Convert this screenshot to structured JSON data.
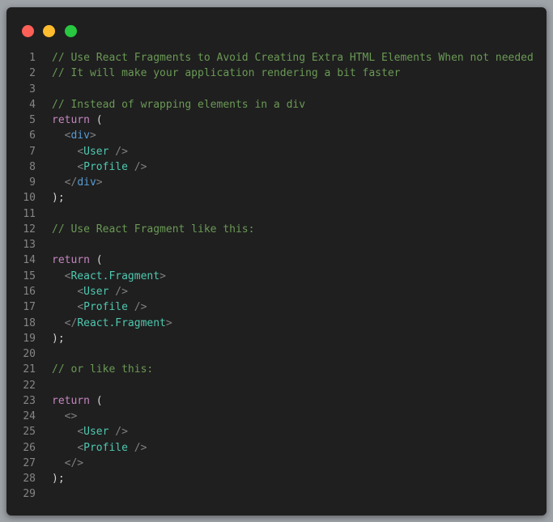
{
  "editor": {
    "lines": [
      {
        "n": "1",
        "tokens": [
          {
            "t": "// Use React Fragments to Avoid Creating Extra HTML Elements When not needed",
            "c": "comment"
          }
        ]
      },
      {
        "n": "2",
        "tokens": [
          {
            "t": "// It will make your application rendering a bit faster",
            "c": "comment"
          }
        ]
      },
      {
        "n": "3",
        "tokens": []
      },
      {
        "n": "4",
        "tokens": [
          {
            "t": "// Instead of wrapping elements in a div",
            "c": "comment"
          }
        ]
      },
      {
        "n": "5",
        "tokens": [
          {
            "t": "return",
            "c": "keyword"
          },
          {
            "t": " (",
            "c": "punct"
          }
        ]
      },
      {
        "n": "6",
        "tokens": [
          {
            "t": "  ",
            "c": "punct"
          },
          {
            "t": "<",
            "c": "tagbr"
          },
          {
            "t": "div",
            "c": "html"
          },
          {
            "t": ">",
            "c": "tagbr"
          }
        ]
      },
      {
        "n": "7",
        "tokens": [
          {
            "t": "    ",
            "c": "punct"
          },
          {
            "t": "<",
            "c": "tagbr"
          },
          {
            "t": "User",
            "c": "comp"
          },
          {
            "t": " />",
            "c": "tagbr"
          }
        ]
      },
      {
        "n": "8",
        "tokens": [
          {
            "t": "    ",
            "c": "punct"
          },
          {
            "t": "<",
            "c": "tagbr"
          },
          {
            "t": "Profile",
            "c": "comp"
          },
          {
            "t": " />",
            "c": "tagbr"
          }
        ]
      },
      {
        "n": "9",
        "tokens": [
          {
            "t": "  ",
            "c": "punct"
          },
          {
            "t": "</",
            "c": "tagbr"
          },
          {
            "t": "div",
            "c": "html"
          },
          {
            "t": ">",
            "c": "tagbr"
          }
        ]
      },
      {
        "n": "10",
        "tokens": [
          {
            "t": ");",
            "c": "punct"
          }
        ]
      },
      {
        "n": "11",
        "tokens": []
      },
      {
        "n": "12",
        "tokens": [
          {
            "t": "// Use React Fragment like this:",
            "c": "comment"
          }
        ]
      },
      {
        "n": "13",
        "tokens": []
      },
      {
        "n": "14",
        "tokens": [
          {
            "t": "return",
            "c": "keyword"
          },
          {
            "t": " (",
            "c": "punct"
          }
        ]
      },
      {
        "n": "15",
        "tokens": [
          {
            "t": "  ",
            "c": "punct"
          },
          {
            "t": "<",
            "c": "tagbr"
          },
          {
            "t": "React.Fragment",
            "c": "comp"
          },
          {
            "t": ">",
            "c": "tagbr"
          }
        ]
      },
      {
        "n": "16",
        "tokens": [
          {
            "t": "    ",
            "c": "punct"
          },
          {
            "t": "<",
            "c": "tagbr"
          },
          {
            "t": "User",
            "c": "comp"
          },
          {
            "t": " />",
            "c": "tagbr"
          }
        ]
      },
      {
        "n": "17",
        "tokens": [
          {
            "t": "    ",
            "c": "punct"
          },
          {
            "t": "<",
            "c": "tagbr"
          },
          {
            "t": "Profile",
            "c": "comp"
          },
          {
            "t": " />",
            "c": "tagbr"
          }
        ]
      },
      {
        "n": "18",
        "tokens": [
          {
            "t": "  ",
            "c": "punct"
          },
          {
            "t": "</",
            "c": "tagbr"
          },
          {
            "t": "React.Fragment",
            "c": "comp"
          },
          {
            "t": ">",
            "c": "tagbr"
          }
        ]
      },
      {
        "n": "19",
        "tokens": [
          {
            "t": ");",
            "c": "punct"
          }
        ]
      },
      {
        "n": "20",
        "tokens": []
      },
      {
        "n": "21",
        "tokens": [
          {
            "t": "// or like this:",
            "c": "comment"
          }
        ]
      },
      {
        "n": "22",
        "tokens": []
      },
      {
        "n": "23",
        "tokens": [
          {
            "t": "return",
            "c": "keyword"
          },
          {
            "t": " (",
            "c": "punct"
          }
        ]
      },
      {
        "n": "24",
        "tokens": [
          {
            "t": "  ",
            "c": "punct"
          },
          {
            "t": "<>",
            "c": "tagbr"
          }
        ]
      },
      {
        "n": "25",
        "tokens": [
          {
            "t": "    ",
            "c": "punct"
          },
          {
            "t": "<",
            "c": "tagbr"
          },
          {
            "t": "User",
            "c": "comp"
          },
          {
            "t": " />",
            "c": "tagbr"
          }
        ]
      },
      {
        "n": "26",
        "tokens": [
          {
            "t": "    ",
            "c": "punct"
          },
          {
            "t": "<",
            "c": "tagbr"
          },
          {
            "t": "Profile",
            "c": "comp"
          },
          {
            "t": " />",
            "c": "tagbr"
          }
        ]
      },
      {
        "n": "27",
        "tokens": [
          {
            "t": "  ",
            "c": "punct"
          },
          {
            "t": "</>",
            "c": "tagbr"
          }
        ]
      },
      {
        "n": "28",
        "tokens": [
          {
            "t": ");",
            "c": "punct"
          }
        ]
      },
      {
        "n": "29",
        "tokens": []
      }
    ]
  },
  "colors": {
    "window_bg": "#1f1f1f",
    "close": "#fe5f57",
    "minimize": "#febc2e",
    "maximize": "#28c840",
    "comment": "#6a9955",
    "keyword": "#c586c0",
    "html_tag": "#569cd6",
    "component": "#4ec9b0",
    "line_number": "#858585"
  }
}
